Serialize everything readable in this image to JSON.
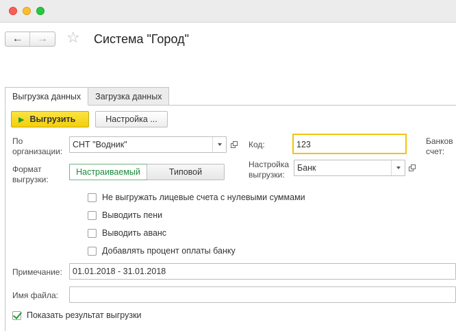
{
  "window": {
    "title": "Система \"Город\""
  },
  "nav": {
    "back_icon": "arrow-left-icon",
    "forward_icon": "arrow-right-icon",
    "star_icon": "star-icon"
  },
  "tabs": [
    {
      "label": "Выгрузка данных",
      "active": true
    },
    {
      "label": "Загрузка данных",
      "active": false
    }
  ],
  "toolbar": {
    "export_label": "Выгрузить",
    "settings_label": "Настройка ..."
  },
  "form": {
    "org_label": "По организации:",
    "org_value": "СНТ \"Водник\"",
    "code_label": "Код:",
    "code_value": "123",
    "bank_account_label": "Банков счет:",
    "format_label": "Формат выгрузки:",
    "format_options": [
      "Настраиваемый",
      "Типовой"
    ],
    "format_selected": "Настраиваемый",
    "export_setting_label": "Настройка выгрузки:",
    "export_setting_value": "Банк",
    "checkboxes": [
      {
        "label": "Не выгружать лицевые счета с нулевыми суммами",
        "checked": false
      },
      {
        "label": "Выводить пени",
        "checked": false
      },
      {
        "label": "Выводить аванс",
        "checked": false
      },
      {
        "label": "Добавлять процент оплаты банку",
        "checked": false
      }
    ],
    "note_label": "Примечание:",
    "note_value": "01.01.2018 - 31.01.2018",
    "filename_label": "Имя файла:",
    "filename_value": "",
    "show_result_label": "Показать результат выгрузки",
    "show_result_checked": true
  },
  "colors": {
    "accent_yellow": "#f3cf0c",
    "focus_border": "#f1c40f",
    "selected_green": "#1a8a3a"
  }
}
